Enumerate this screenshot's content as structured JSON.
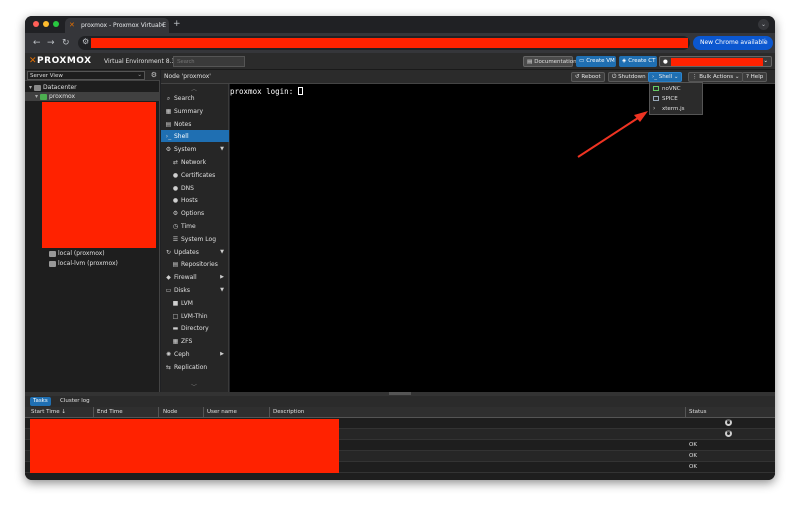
{
  "browser": {
    "tab_title": "proxmox - Proxmox Virtual E",
    "tab_favicon": "proxmox-x-icon",
    "new_tab": "+",
    "chrome_available": "New Chrome available",
    "colors": {
      "traffic_red": "#ff5f57",
      "traffic_yellow": "#febc2e",
      "traffic_green": "#28c840",
      "accent": "#0b57d0",
      "redaction": "#ff2200"
    }
  },
  "header": {
    "logo_text": "PROXMOX",
    "version": "Virtual Environment 8.3.0",
    "search_placeholder": "Search",
    "documentation": "Documentation",
    "create_vm": "Create VM",
    "create_ct": "Create CT"
  },
  "tree": {
    "view": "Server View",
    "datacenter": "Datacenter",
    "node": "proxmox",
    "storages": [
      "local (proxmox)",
      "local-lvm (proxmox)"
    ]
  },
  "node_header": {
    "title": "Node 'proxmox'",
    "reboot": "Reboot",
    "shutdown": "Shutdown",
    "shell": "Shell",
    "bulk_actions": "Bulk Actions",
    "help": "Help"
  },
  "nav": {
    "items": [
      {
        "label": "Search",
        "icon": "search-icon",
        "sub": false
      },
      {
        "label": "Summary",
        "icon": "summary-icon",
        "sub": false
      },
      {
        "label": "Notes",
        "icon": "notes-icon",
        "sub": false
      },
      {
        "label": "Shell",
        "icon": "terminal-icon",
        "sub": false,
        "selected": true
      },
      {
        "label": "System",
        "icon": "gears-icon",
        "sub": false,
        "expand": true
      },
      {
        "label": "Network",
        "icon": "network-icon",
        "sub": true
      },
      {
        "label": "Certificates",
        "icon": "certificate-icon",
        "sub": true
      },
      {
        "label": "DNS",
        "icon": "globe-icon",
        "sub": true
      },
      {
        "label": "Hosts",
        "icon": "globe-icon",
        "sub": true
      },
      {
        "label": "Options",
        "icon": "gear-icon",
        "sub": true
      },
      {
        "label": "Time",
        "icon": "clock-icon",
        "sub": true
      },
      {
        "label": "System Log",
        "icon": "list-icon",
        "sub": true
      },
      {
        "label": "Updates",
        "icon": "refresh-icon",
        "sub": false,
        "expand": true
      },
      {
        "label": "Repositories",
        "icon": "files-icon",
        "sub": true
      },
      {
        "label": "Firewall",
        "icon": "shield-icon",
        "sub": false,
        "arrow": true
      },
      {
        "label": "Disks",
        "icon": "hdd-icon",
        "sub": false,
        "expand": true
      },
      {
        "label": "LVM",
        "icon": "square-icon",
        "sub": true
      },
      {
        "label": "LVM-Thin",
        "icon": "square-outline-icon",
        "sub": true
      },
      {
        "label": "Directory",
        "icon": "folder-icon",
        "sub": true
      },
      {
        "label": "ZFS",
        "icon": "grid-icon",
        "sub": true
      },
      {
        "label": "Ceph",
        "icon": "ceph-icon",
        "sub": false,
        "arrow": true
      },
      {
        "label": "Replication",
        "icon": "retweet-icon",
        "sub": false
      }
    ]
  },
  "terminal": {
    "prompt": "proxmox login: "
  },
  "shell_menu": {
    "items": [
      "noVNC",
      "SPICE",
      "xterm.js"
    ]
  },
  "bottom": {
    "tabs": [
      "Tasks",
      "Cluster log"
    ],
    "columns": [
      "Start Time",
      "End Time",
      "Node",
      "User name",
      "Description",
      "Status"
    ],
    "sort_indicator": "↓",
    "statuses": [
      "",
      "",
      "OK",
      "OK",
      "OK"
    ]
  }
}
